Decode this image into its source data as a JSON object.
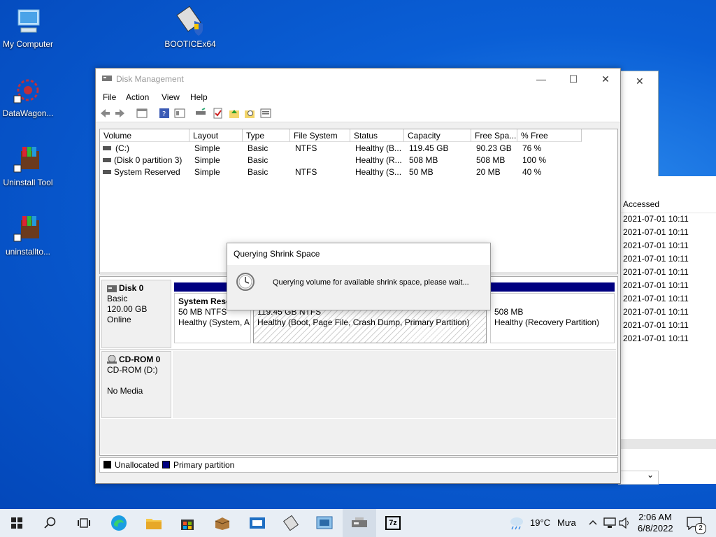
{
  "desktop": {
    "icons": [
      {
        "label": "My Computer"
      },
      {
        "label": "BOOTICEx64"
      },
      {
        "label": "DataWagon..."
      },
      {
        "label": "Uninstall Tool"
      },
      {
        "label": "uninstallto..."
      }
    ]
  },
  "background_window": {
    "column_header": "Accessed",
    "rows": [
      "2021-07-01 10:11",
      "2021-07-01 10:11",
      "2021-07-01 10:11",
      "2021-07-01 10:11",
      "2021-07-01 10:11",
      "2021-07-01 10:11",
      "2021-07-01 10:11",
      "2021-07-01 10:11",
      "2021-07-01 10:11",
      "2021-07-01 10:11"
    ],
    "close_glyph": "✕",
    "scroll_down_glyph": "⌄"
  },
  "window": {
    "title": "Disk Management",
    "minimize": "—",
    "maximize": "☐",
    "close": "✕",
    "menu": [
      "File",
      "Action",
      "View",
      "Help"
    ],
    "toolbar": [
      "back-icon",
      "forward-icon",
      "properties-icon",
      "help-icon",
      "console-icon",
      "connect-icon",
      "check-icon",
      "up-icon",
      "search-icon",
      "list-icon"
    ]
  },
  "volumes": {
    "headers": [
      "Volume",
      "Layout",
      "Type",
      "File System",
      "Status",
      "Capacity",
      "Free Spa...",
      "% Free"
    ],
    "rows": [
      [
        "(C:)",
        "Simple",
        "Basic",
        "NTFS",
        "Healthy (B...",
        "119.45 GB",
        "90.23 GB",
        "76 %"
      ],
      [
        "(Disk 0 partition 3)",
        "Simple",
        "Basic",
        "",
        "Healthy (R...",
        "508 MB",
        "508 MB",
        "100 %"
      ],
      [
        "System Reserved",
        "Simple",
        "Basic",
        "NTFS",
        "Healthy (S...",
        "50 MB",
        "20 MB",
        "40 %"
      ]
    ]
  },
  "disks": {
    "disk0": {
      "name": "Disk 0",
      "type": "Basic",
      "size": "120.00 GB",
      "state": "Online",
      "partitions": [
        {
          "name": "System Rese",
          "fs": "50 MB NTFS",
          "status": "Healthy (System, A"
        },
        {
          "name": "",
          "fs": "119.45 GB NTFS",
          "status": "Healthy (Boot, Page File, Crash Dump, Primary Partition)"
        },
        {
          "name": "",
          "fs": "508 MB",
          "status": "Healthy (Recovery Partition)"
        }
      ]
    },
    "cdrom0": {
      "name": "CD-ROM 0",
      "type": "CD-ROM (D:)",
      "media": "No Media"
    }
  },
  "legend": {
    "unallocated": "Unallocated",
    "primary": "Primary partition",
    "colors": {
      "unallocated": "#000000",
      "primary": "#000080"
    }
  },
  "dialog": {
    "title": "Querying Shrink Space",
    "message": "Querying volume for available shrink space, please wait..."
  },
  "taskbar": {
    "weather_temp": "19°C",
    "weather_desc": "Mưa",
    "time": "2:06 AM",
    "date": "6/8/2022",
    "notification_count": "2",
    "app_7z_label": "7z"
  }
}
